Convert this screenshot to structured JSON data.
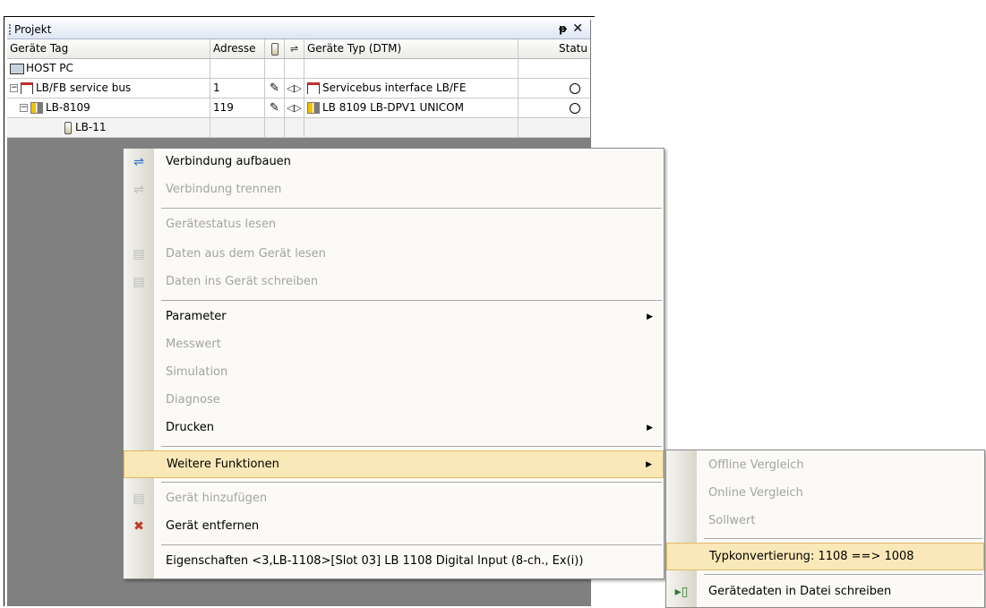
{
  "panel": {
    "title": "Projekt",
    "pin_glyph": "📌",
    "close_glyph": "✕"
  },
  "grid": {
    "headers": {
      "tag": "Geräte Tag",
      "address": "Adresse",
      "type": "Geräte Typ (DTM)",
      "status": "Statu"
    },
    "rows": [
      {
        "tag": "HOST PC",
        "address": "",
        "type": "",
        "icon": "host-pc-icon"
      },
      {
        "tag": "LB/FB service bus",
        "address": "1",
        "type": "Servicebus interface LB/FE",
        "icon": "servicebus-icon"
      },
      {
        "tag": "LB-8109",
        "address": "119",
        "type": "LB 8109 LB-DPV1 UNICOM",
        "icon": "device-icon"
      },
      {
        "tag": "LB-11",
        "address": "",
        "type": "",
        "icon": "slot-icon"
      }
    ]
  },
  "context_menu": {
    "items": [
      {
        "label": "Verbindung aufbauen",
        "icon": "connect-icon",
        "disabled": false
      },
      {
        "label": "Verbindung trennen",
        "icon": "disconnect-icon",
        "disabled": true
      },
      {
        "label": "Gerätestatus lesen",
        "disabled": true
      },
      {
        "label": "Daten aus dem Gerät lesen",
        "icon": "read-device-icon",
        "disabled": true
      },
      {
        "label": "Daten ins Gerät schreiben",
        "icon": "write-device-icon",
        "disabled": true
      },
      {
        "label": "Parameter",
        "disabled": false,
        "submenu": true
      },
      {
        "label": "Messwert",
        "disabled": true
      },
      {
        "label": "Simulation",
        "disabled": true
      },
      {
        "label": "Diagnose",
        "disabled": true
      },
      {
        "label": "Drucken",
        "disabled": false,
        "submenu": true
      },
      {
        "label": "Weitere Funktionen",
        "disabled": false,
        "submenu": true,
        "highlighted": true
      },
      {
        "label": "Gerät hinzufügen",
        "icon": "add-device-icon",
        "disabled": true
      },
      {
        "label": "Gerät entfernen",
        "icon": "remove-device-icon",
        "disabled": false
      },
      {
        "label": "Eigenschaften <3,LB-1108>[Slot 03] LB 1108 Digital Input (8-ch., Ex(i))",
        "disabled": false
      }
    ]
  },
  "submenu": {
    "items": [
      {
        "label": "Offline Vergleich",
        "disabled": true
      },
      {
        "label": "Online Vergleich",
        "disabled": true
      },
      {
        "label": "Sollwert",
        "disabled": true
      },
      {
        "label": "Typkonvertierung: 1108 ==> 1008",
        "disabled": false,
        "highlighted": true
      },
      {
        "label": "Gerätedaten in Datei schreiben",
        "icon": "export-device-data-icon",
        "disabled": false
      }
    ]
  },
  "colors": {
    "highlight_bg": "#fbe8b8",
    "highlight_border": "#e0b964",
    "disabled_text": "#a3a3a3"
  }
}
